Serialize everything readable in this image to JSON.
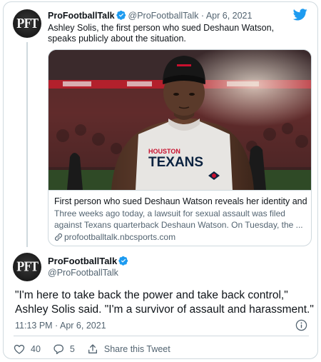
{
  "quoted": {
    "name": "ProFootballTalk",
    "handle": "@ProFootballTalk",
    "separator": "·",
    "date": "Apr 6, 2021",
    "text": "Ashley Solis, the first person who sued Deshaun Watson, speaks publicly about the situation.",
    "avatar_text": "PFT"
  },
  "link_card": {
    "title": "First person who sued Deshaun Watson reveals her identity and ...",
    "description": "Three weeks ago today, a lawsuit for sexual assault was filed against Texans quarterback Deshaun Watson. On Tuesday, the ...",
    "domain": "profootballtalk.nbcsports.com",
    "jersey_line1": "HOUSTON",
    "jersey_line2": "TEXANS"
  },
  "tweet": {
    "name": "ProFootballTalk",
    "handle": "@ProFootballTalk",
    "avatar_text": "PFT",
    "text": "\"I'm here to take back the power and take back control,\" Ashley Solis said. \"I'm a survivor of assault and harassment.\"",
    "timestamp": "11:13 PM · Apr 6, 2021",
    "likes": "40",
    "replies": "5",
    "share_label": "Share this Tweet"
  },
  "colors": {
    "twitter_blue": "#1d9bf0",
    "secondary_text": "#536471",
    "border": "#cfd9de",
    "texans_red": "#c8102e"
  },
  "icons": [
    "twitter-bird-icon",
    "verified-badge-icon",
    "link-icon",
    "info-icon",
    "heart-icon",
    "reply-icon",
    "share-icon"
  ]
}
